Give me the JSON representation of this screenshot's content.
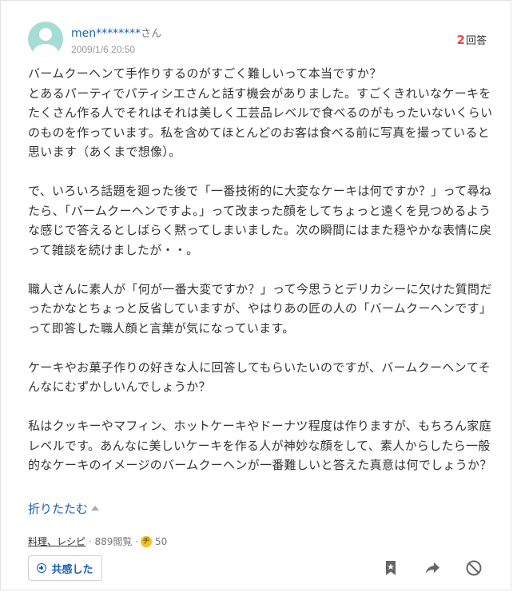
{
  "user": {
    "name": "men********",
    "suffix": "さん",
    "date": "2009/1/6 20:50"
  },
  "answers": {
    "count": "2",
    "label": "回答"
  },
  "question": {
    "body": "バームクーヘンて手作りするのがすごく難しいって本当ですか？\nとあるパーティでパティシエさんと話す機会がありました。すごくきれいなケーキをたくさん作る人でそれはそれは美しく工芸品レベルで食べるのがもったいないくらいのものを作っています。私を含めてほとんどのお客は食べる前に写真を撮っていると思います（あくまで想像）。\n\nで、いろいろ話題を廻った後で「一番技術的に大変なケーキは何ですか？」って尋ねたら、「バームクーヘンですよ。」って改まった顔をしてちょっと遠くを見つめるような感じで答えるとしばらく黙ってしまいました。次の瞬間にはまた穏やかな表情に戻って雑談を続けましたが・・。\n\n職人さんに素人が「何が一番大変ですか？」って今思うとデリカシーに欠けた質問だったかなとちょっと反省していますが、やはりあの匠の人の「バームクーヘンです」って即答した職人顔と言葉が気になっています。\n\nケーキやお菓子作りの好きな人に回答してもらいたいのですが、バームクーヘンてそんなにむずかしいんでしょうか？\n\n私はクッキーやマフィン、ホットケーキやドーナツ程度は作りますが、もちろん家庭レベルです。あんなに美しいケーキを作る人が神妙な顔をして、素人からしたら一般的なケーキのイメージのバームクーヘンが一番難しいと答えた真意は何でしょうか？"
  },
  "collapse_label": "折りたたむ",
  "meta": {
    "category": "料理、レシピ",
    "views": "889閲覧",
    "coin_glyph": "チ",
    "coins": "50"
  },
  "actions": {
    "empathy_label": "共感した"
  },
  "colors": {
    "link": "#1a5fb4",
    "answer_count": "#e54b4b",
    "avatar": "#a6dcd6",
    "coin": "#f2c12e"
  }
}
